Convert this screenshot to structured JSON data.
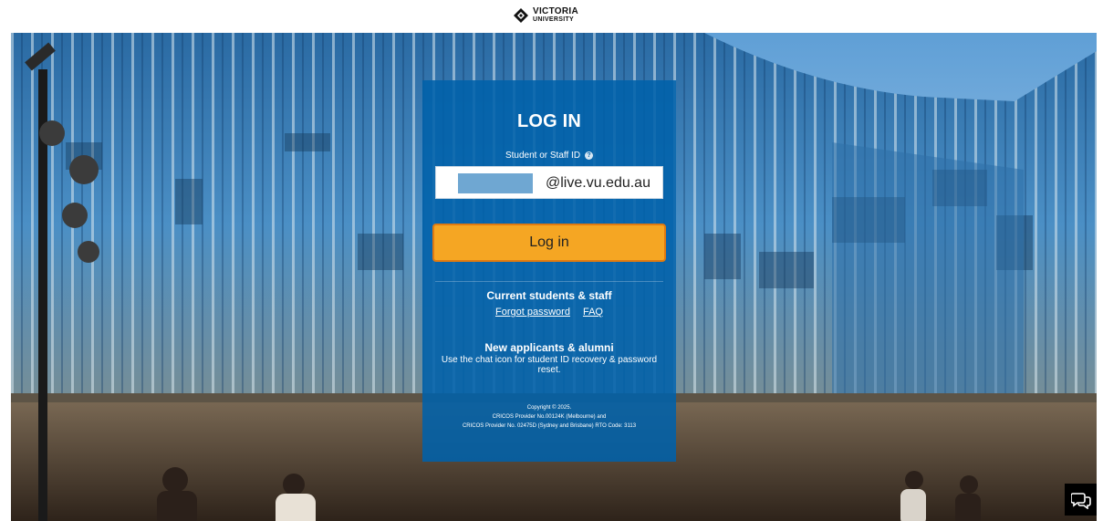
{
  "header": {
    "logo_line1": "VICTORIA",
    "logo_line2": "UNIVERSITY",
    "logo_icon": "diamond-logo-icon"
  },
  "login": {
    "title": "LOG IN",
    "id_label": "Student or Staff ID",
    "help_icon": "question-icon",
    "id_suffix": "@live.vu.edu.au",
    "button_label": "Log in"
  },
  "current": {
    "title": "Current students & staff",
    "forgot_password": "Forgot password",
    "faq": "FAQ"
  },
  "applicants": {
    "title": "New applicants & alumni",
    "info": "Use the chat icon for student ID recovery & password reset."
  },
  "footer": {
    "line1": "Copyright © 2025.",
    "line2": "CRICOS Provider No.00124K (Melbourne) and",
    "line3": "CRICOS Provider No. 02475D (Sydney and Brisbane) RTO Code: 3113"
  },
  "chat": {
    "icon": "chat-bubbles-icon"
  },
  "colors": {
    "panel": "#0061aa",
    "button": "#f5a623",
    "button_border": "#e07a10"
  }
}
